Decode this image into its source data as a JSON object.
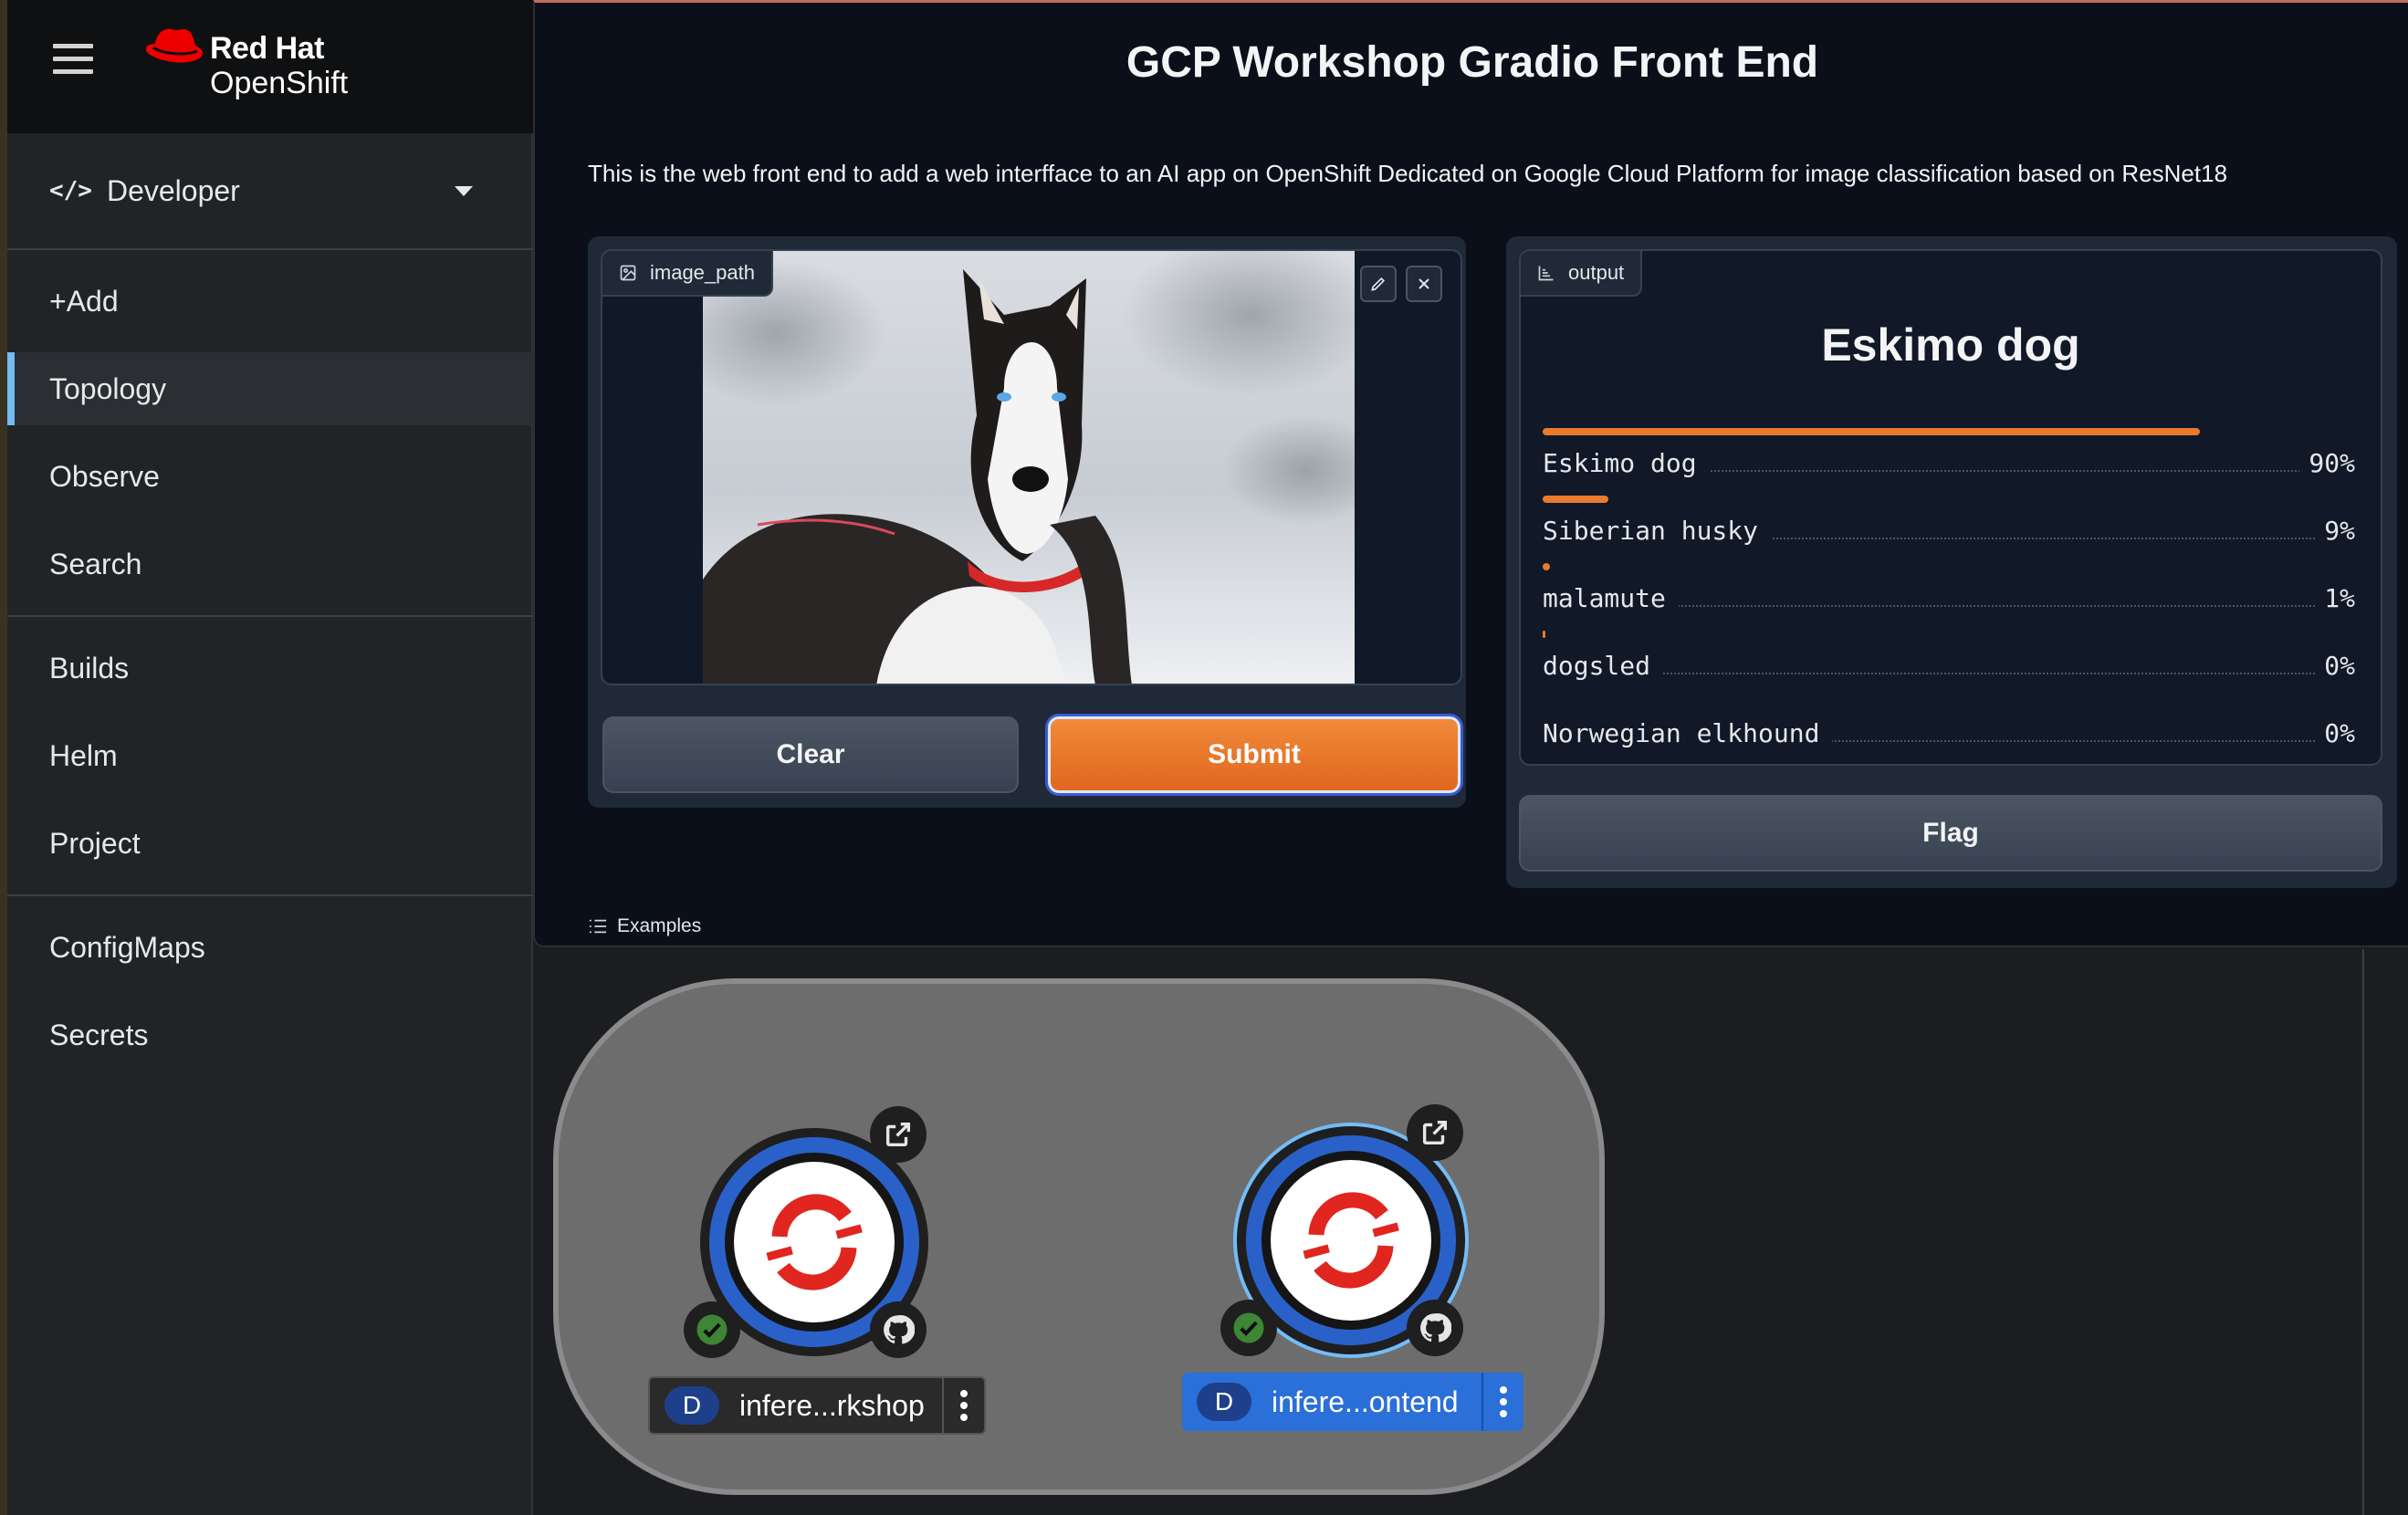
{
  "masthead": {
    "brand_line1": "Red Hat",
    "brand_line2": "OpenShift"
  },
  "perspective": {
    "icon": "</>",
    "label": "Developer"
  },
  "nav": {
    "add": "+Add",
    "topology": "Topology",
    "observe": "Observe",
    "search": "Search",
    "builds": "Builds",
    "helm": "Helm",
    "project": "Project",
    "configmaps": "ConfigMaps",
    "secrets": "Secrets",
    "active": "Topology"
  },
  "gradio": {
    "title": "GCP Workshop Gradio Front End",
    "description": "This is the web front end to add a web interfface to an AI app on OpenShift Dedicated on Google Cloud Platform for image classification based on ResNet18",
    "input_label": "image_path",
    "clear_label": "Clear",
    "submit_label": "Submit",
    "output_label": "output",
    "result_title": "Eskimo dog",
    "confidences": [
      {
        "label": "Eskimo dog",
        "value": "90%",
        "fraction": 0.9
      },
      {
        "label": "Siberian husky",
        "value": "9%",
        "fraction": 0.09
      },
      {
        "label": "malamute",
        "value": "1%",
        "fraction": 0.01
      },
      {
        "label": "dogsled",
        "value": "0%",
        "fraction": 0.003
      },
      {
        "label": "Norwegian elkhound",
        "value": "0%",
        "fraction": 0.0
      }
    ],
    "flag_label": "Flag",
    "examples_label": "Examples"
  },
  "topology": {
    "nodes": [
      {
        "badge": "D",
        "name": "infere...rkshop",
        "status": "ok",
        "selected": false
      },
      {
        "badge": "D",
        "name": "infere...ontend",
        "status": "ok",
        "selected": true
      }
    ]
  },
  "colors": {
    "accent_orange": "#ea7a2c",
    "primary_button": "#e86f24",
    "pod_ring_blue": "#2a61c9",
    "openshift_red": "#e0261f",
    "status_green": "#3e8635",
    "selection_blue": "#2b6fd8"
  }
}
